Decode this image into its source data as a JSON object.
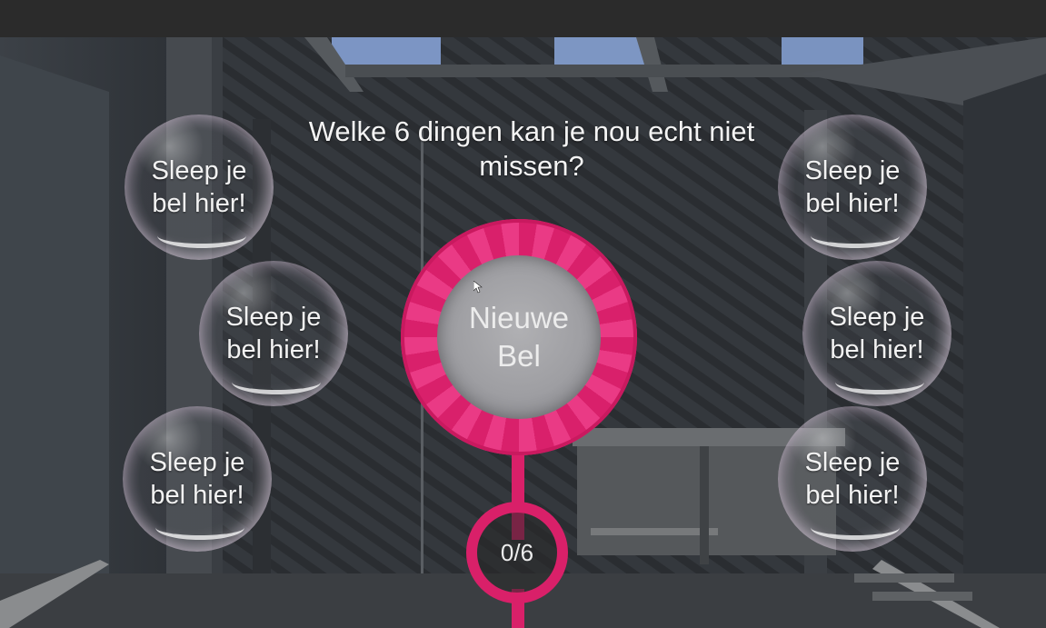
{
  "question": "Welke 6 dingen kan je nou echt niet missen?",
  "slot_label": "Sleep je bel hier!",
  "slots": [
    {
      "label": "Sleep je bel hier!"
    },
    {
      "label": "Sleep je bel hier!"
    },
    {
      "label": "Sleep je bel hier!"
    },
    {
      "label": "Sleep je bel hier!"
    },
    {
      "label": "Sleep je bel hier!"
    },
    {
      "label": "Sleep je bel hier!"
    }
  ],
  "new_bubble": {
    "label": "Nieuwe Bel"
  },
  "counter": {
    "text": "0/6",
    "current": 0,
    "total": 6
  },
  "colors": {
    "accent": "#d92069",
    "text": "#f4f4f4"
  }
}
